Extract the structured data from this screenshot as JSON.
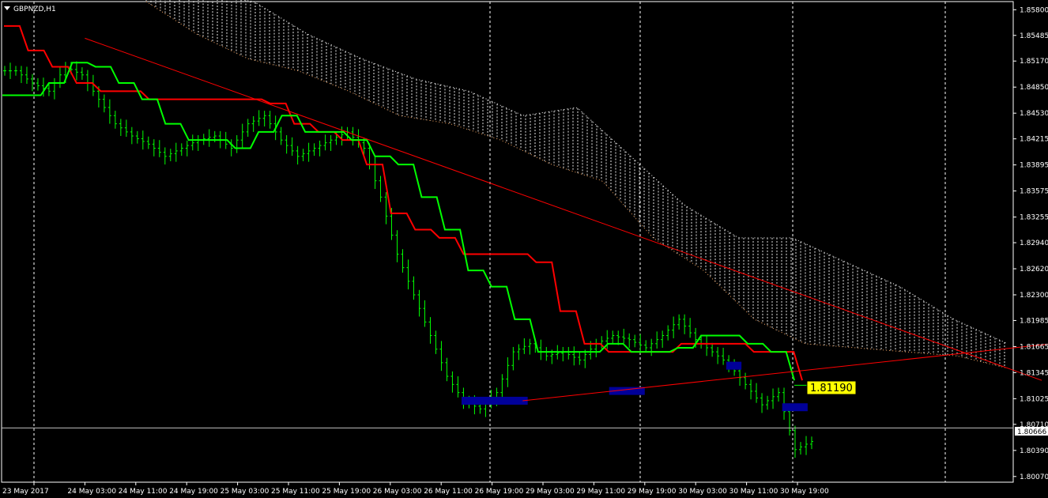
{
  "window": {
    "symbol_label": "GBPNZD,H1"
  },
  "colors": {
    "background": "#000000",
    "bar": "#00ff00",
    "kijun": "#ff0000",
    "tenkan": "#00ff00",
    "cloud": "#ffffff",
    "cloud_lower": "#f4a460",
    "trendline": "#ff0000",
    "zone": "#000099",
    "current_price_label_bg": "#ffff00",
    "axis_text": "#ffffff",
    "grid": "#ffffff"
  },
  "chart_data": {
    "type": "ohlc",
    "symbol": "GBPNZD",
    "timeframe": "H1",
    "x_axis_labels": [
      "23 May 2017",
      "24 May 03:00",
      "24 May 11:00",
      "24 May 19:00",
      "25 May 03:00",
      "25 May 11:00",
      "25 May 19:00",
      "26 May 03:00",
      "26 May 11:00",
      "26 May 19:00",
      "29 May 03:00",
      "29 May 11:00",
      "29 May 19:00",
      "30 May 03:00",
      "30 May 11:00",
      "30 May 19:00"
    ],
    "y_axis_labels": [
      "1.85800",
      "1.85485",
      "1.85170",
      "1.84850",
      "1.84530",
      "1.84215",
      "1.83895",
      "1.83575",
      "1.83255",
      "1.82940",
      "1.82620",
      "1.82300",
      "1.81985",
      "1.81665",
      "1.81345",
      "1.81025",
      "1.80710",
      "1.80390",
      "1.80070"
    ],
    "ylim": [
      1.8,
      1.859
    ],
    "grid": "vertical dashed",
    "current_price": "1.81190",
    "horizontal_line_price": "1.80666",
    "series": [
      {
        "name": "",
        "kind": "price_close",
        "values": [
          1.8505,
          1.849,
          1.848,
          1.851,
          1.85,
          1.847,
          1.844,
          1.8425,
          1.8415,
          1.84,
          1.841,
          1.842,
          1.8425,
          1.841,
          1.844,
          1.845,
          1.842,
          1.84,
          1.841,
          1.842,
          1.843,
          1.841,
          1.835,
          1.828,
          1.823,
          1.818,
          1.813,
          1.81,
          1.809,
          1.811,
          1.816,
          1.817,
          1.8155,
          1.816,
          1.815,
          1.817,
          1.818,
          1.8175,
          1.8165,
          1.818,
          1.82,
          1.8175,
          1.816,
          1.8145,
          1.812,
          1.8095,
          1.811,
          1.804,
          1.805
        ]
      },
      {
        "name": "",
        "kind": "kijun",
        "values": [
          1.856,
          1.853,
          1.851,
          1.849,
          1.848,
          1.848,
          1.847,
          1.847,
          1.847,
          1.847,
          1.847,
          1.8465,
          1.844,
          1.843,
          1.842,
          1.839,
          1.833,
          1.831,
          1.83,
          1.828,
          1.828,
          1.828,
          1.827,
          1.821,
          1.817,
          1.816,
          1.816,
          1.816,
          1.817,
          1.817,
          1.817,
          1.816,
          1.816,
          1.8125
        ]
      },
      {
        "name": "",
        "kind": "tenkan",
        "values": [
          1.8475,
          1.8475,
          1.849,
          1.8515,
          1.851,
          1.849,
          1.847,
          1.844,
          1.842,
          1.842,
          1.841,
          1.843,
          1.845,
          1.843,
          1.843,
          1.842,
          1.84,
          1.839,
          1.835,
          1.831,
          1.826,
          1.824,
          1.82,
          1.816,
          1.816,
          1.816,
          1.817,
          1.816,
          1.816,
          1.8165,
          1.818,
          1.818,
          1.817,
          1.816,
          1.8125
        ]
      }
    ],
    "cloud": {
      "upper": [
        1.862,
        1.86,
        1.859,
        1.855,
        1.852,
        1.8495,
        1.848,
        1.845,
        1.846,
        1.84,
        1.834,
        1.83,
        1.83,
        1.827,
        1.824,
        1.82,
        1.817
      ],
      "lower": [
        1.859,
        1.855,
        1.852,
        1.8505,
        1.848,
        1.845,
        1.844,
        1.842,
        1.839,
        1.837,
        1.83,
        1.826,
        1.82,
        1.817,
        1.8165,
        1.816,
        1.8155,
        1.814
      ]
    },
    "trendlines": [
      {
        "name": "",
        "from": [
          1,
          1.8545
        ],
        "to": [
          19.8,
          1.8125
        ]
      },
      {
        "name": "",
        "from": [
          9.6,
          1.81
        ],
        "to": [
          20,
          1.817
        ]
      }
    ],
    "zones": [
      {
        "name": "",
        "x_range": [
          8.4,
          9.7
        ],
        "price": 1.81
      },
      {
        "name": "",
        "x_range": [
          11.3,
          12.0
        ],
        "price": 1.8112
      },
      {
        "name": "",
        "x_range": [
          13.6,
          13.9
        ],
        "price": 1.8143
      },
      {
        "name": "",
        "x_range": [
          14.7,
          15.2
        ],
        "price": 1.8092
      }
    ]
  }
}
